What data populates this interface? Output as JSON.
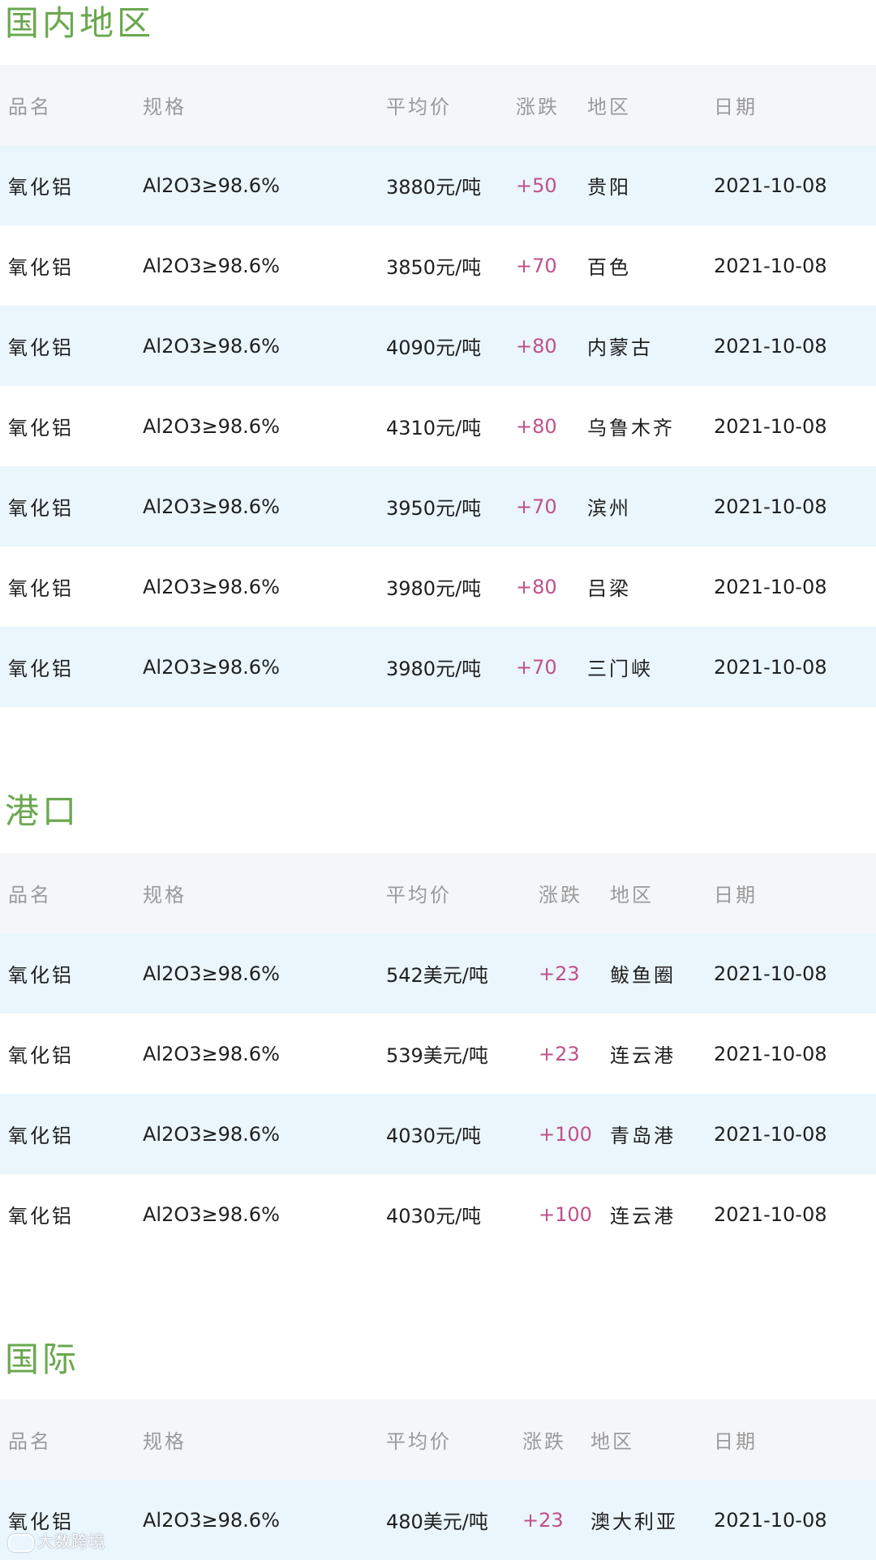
{
  "sections": [
    {
      "title": "国内地区",
      "headers": [
        "品名",
        "规格",
        "平均价",
        "涨跌",
        "地区",
        "日期"
      ],
      "rows": [
        [
          "氧化铝",
          "Al2O3≥98.6%",
          "3880元/吨",
          "+50",
          "贵阳",
          "2021-10-08"
        ],
        [
          "氧化铝",
          "Al2O3≥98.6%",
          "3850元/吨",
          "+70",
          "百色",
          "2021-10-08"
        ],
        [
          "氧化铝",
          "Al2O3≥98.6%",
          "4090元/吨",
          "+80",
          "内蒙古",
          "2021-10-08"
        ],
        [
          "氧化铝",
          "Al2O3≥98.6%",
          "4310元/吨",
          "+80",
          "乌鲁木齐",
          "2021-10-08"
        ],
        [
          "氧化铝",
          "Al2O3≥98.6%",
          "3950元/吨",
          "+70",
          "滨州",
          "2021-10-08"
        ],
        [
          "氧化铝",
          "Al2O3≥98.6%",
          "3980元/吨",
          "+80",
          "吕梁",
          "2021-10-08"
        ],
        [
          "氧化铝",
          "Al2O3≥98.6%",
          "3980元/吨",
          "+70",
          "三门峡",
          "2021-10-08"
        ]
      ]
    },
    {
      "title": "港口",
      "headers": [
        "品名",
        "规格",
        "平均价",
        "涨跌",
        "地区",
        "日期"
      ],
      "rows": [
        [
          "氧化铝",
          "Al2O3≥98.6%",
          "542美元/吨",
          "+23",
          "鲅鱼圈",
          "2021-10-08"
        ],
        [
          "氧化铝",
          "Al2O3≥98.6%",
          "539美元/吨",
          "+23",
          "连云港",
          "2021-10-08"
        ],
        [
          "氧化铝",
          "Al2O3≥98.6%",
          "4030元/吨",
          "+100",
          "青岛港",
          "2021-10-08"
        ],
        [
          "氧化铝",
          "Al2O3≥98.6%",
          "4030元/吨",
          "+100",
          "连云港",
          "2021-10-08"
        ]
      ]
    },
    {
      "title": "国际",
      "headers": [
        "品名",
        "规格",
        "平均价",
        "涨跌",
        "地区",
        "日期"
      ],
      "rows": [
        [
          "氧化铝",
          "Al2O3≥98.6%",
          "480美元/吨",
          "+23",
          "澳大利亚",
          "2021-10-08"
        ]
      ]
    }
  ],
  "watermark": "大数跨境",
  "colors": {
    "title": "#6aa84f",
    "change": "#c0508a",
    "header_bg": "#f5f6f8",
    "row_shaded_bg": "#eaf5fc"
  }
}
